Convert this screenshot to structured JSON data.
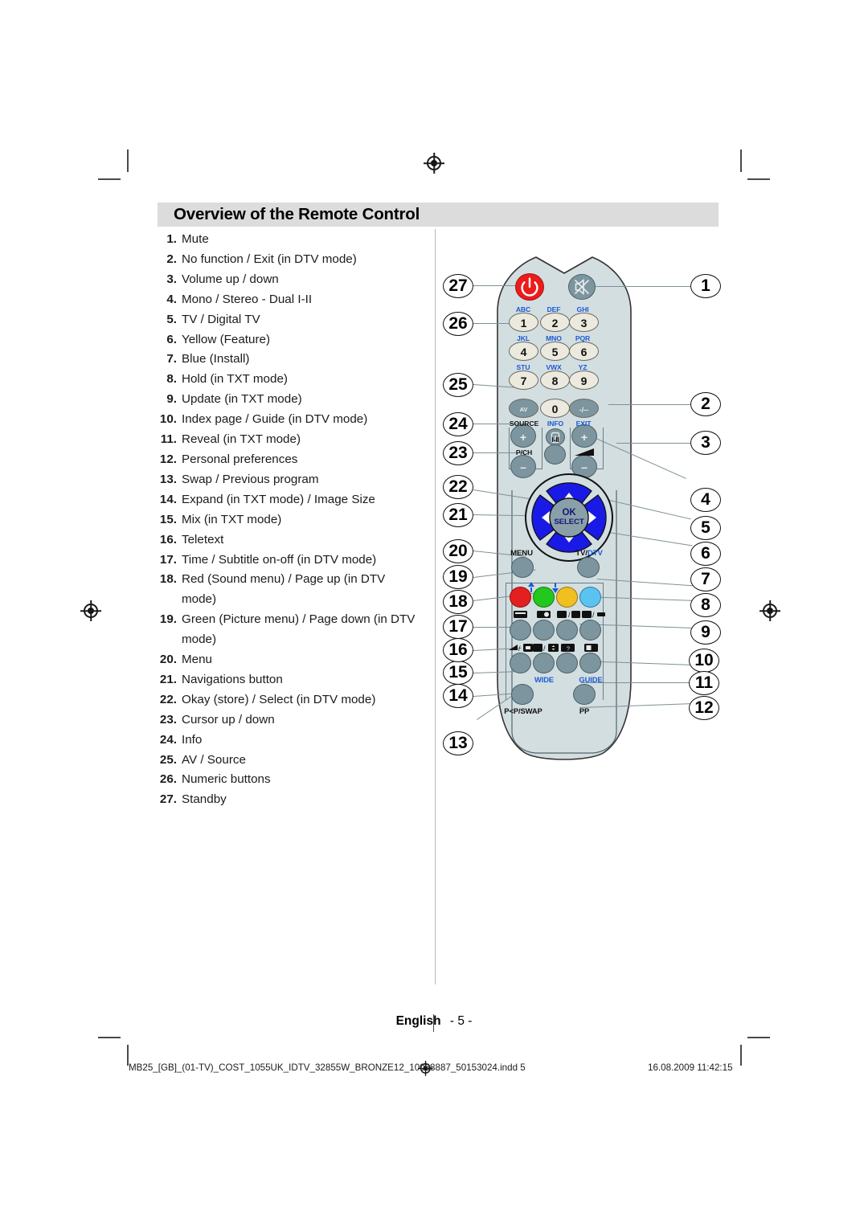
{
  "page": {
    "heading": "Overview of the Remote Control",
    "footer_language": "English",
    "footer_page": "- 5 -",
    "imprint": "MB25_[GB]_(01-TV)_COST_1055UK_IDTV_32855W_BRONZE12_10068887_50153024.indd   5",
    "timestamp": "16.08.2009   11:42:15"
  },
  "features": [
    {
      "num": "1.",
      "text": "Mute"
    },
    {
      "num": "2.",
      "text": "No function / Exit (in DTV mode)"
    },
    {
      "num": "3.",
      "text": "Volume up / down"
    },
    {
      "num": "4.",
      "text": "Mono / Stereo - Dual I-II"
    },
    {
      "num": "5.",
      "text": "TV / Digital TV"
    },
    {
      "num": "6.",
      "text": "Yellow (Feature)"
    },
    {
      "num": "7.",
      "text": "Blue (Install)"
    },
    {
      "num": "8.",
      "text": "Hold (in TXT mode)"
    },
    {
      "num": "9.",
      "text": "Update (in TXT mode)"
    },
    {
      "num": "10.",
      "text": "Index page / Guide (in DTV mode)"
    },
    {
      "num": "11.",
      "text": "Reveal (in TXT mode)"
    },
    {
      "num": "12.",
      "text": "Personal preferences"
    },
    {
      "num": "13.",
      "text": "Swap / Previous program"
    },
    {
      "num": "14.",
      "text": "Expand (in TXT mode) / Image Size"
    },
    {
      "num": "15.",
      "text": "Mix (in TXT mode)"
    },
    {
      "num": "16.",
      "text": "Teletext"
    },
    {
      "num": "17.",
      "text": "Time / Subtitle on-off (in DTV mode)"
    },
    {
      "num": "18.",
      "text": "Red (Sound menu) / Page up (in DTV mode)"
    },
    {
      "num": "19.",
      "text": "Green (Picture menu) / Page down (in DTV mode)"
    },
    {
      "num": "20.",
      "text": "Menu"
    },
    {
      "num": "21.",
      "text": "Navigations button"
    },
    {
      "num": "22.",
      "text": "Okay (store) / Select (in DTV mode)"
    },
    {
      "num": "23.",
      "text": "Cursor up / down"
    },
    {
      "num": "24.",
      "text": "Info"
    },
    {
      "num": "25.",
      "text": "AV / Source"
    },
    {
      "num": "26.",
      "text": "Numeric buttons"
    },
    {
      "num": "27.",
      "text": "Standby"
    }
  ],
  "callouts_right": [
    "1",
    "2",
    "3",
    "4",
    "5",
    "6",
    "7",
    "8",
    "9",
    "10",
    "11",
    "12"
  ],
  "callouts_left": [
    "13",
    "14",
    "15",
    "16",
    "17",
    "18",
    "19",
    "20",
    "21",
    "22",
    "23",
    "24",
    "25",
    "26",
    "27"
  ],
  "remote": {
    "keypad": {
      "keys": [
        {
          "digit": "1",
          "alpha": "ABC"
        },
        {
          "digit": "2",
          "alpha": "DEF"
        },
        {
          "digit": "3",
          "alpha": "GHI"
        },
        {
          "digit": "4",
          "alpha": "JKL"
        },
        {
          "digit": "5",
          "alpha": "MNO"
        },
        {
          "digit": "6",
          "alpha": "PQR"
        },
        {
          "digit": "7",
          "alpha": "STU"
        },
        {
          "digit": "8",
          "alpha": "VWX"
        },
        {
          "digit": "9",
          "alpha": "YZ"
        },
        {
          "digit": "0",
          "alpha": ""
        }
      ]
    },
    "labels": {
      "av": "AV",
      "source": "SOURCE",
      "info": "INFO",
      "exit": "EXIT",
      "dash": "-/--",
      "pch": "P/CH",
      "i_ii": "I-II",
      "plus": "+",
      "minus": "–",
      "ok": "OK",
      "select": "SELECT",
      "menu": "MENU",
      "tv": "TV/",
      "dtv": "DTV",
      "wide": "WIDE",
      "guide": "GUIDE",
      "swap": "P<P/SWAP",
      "pp": "PP"
    },
    "colors": {
      "body": "#d3dee1",
      "power": "#ec1c1c",
      "grey_key": "#7d959e",
      "cream_key": "#eceade",
      "navpad": "#1a1ae6",
      "red": "#e41f1f",
      "green": "#22c81e",
      "yellow": "#f0c020",
      "blue": "#5bc3f0",
      "blue_text": "#1a5ad4"
    }
  }
}
